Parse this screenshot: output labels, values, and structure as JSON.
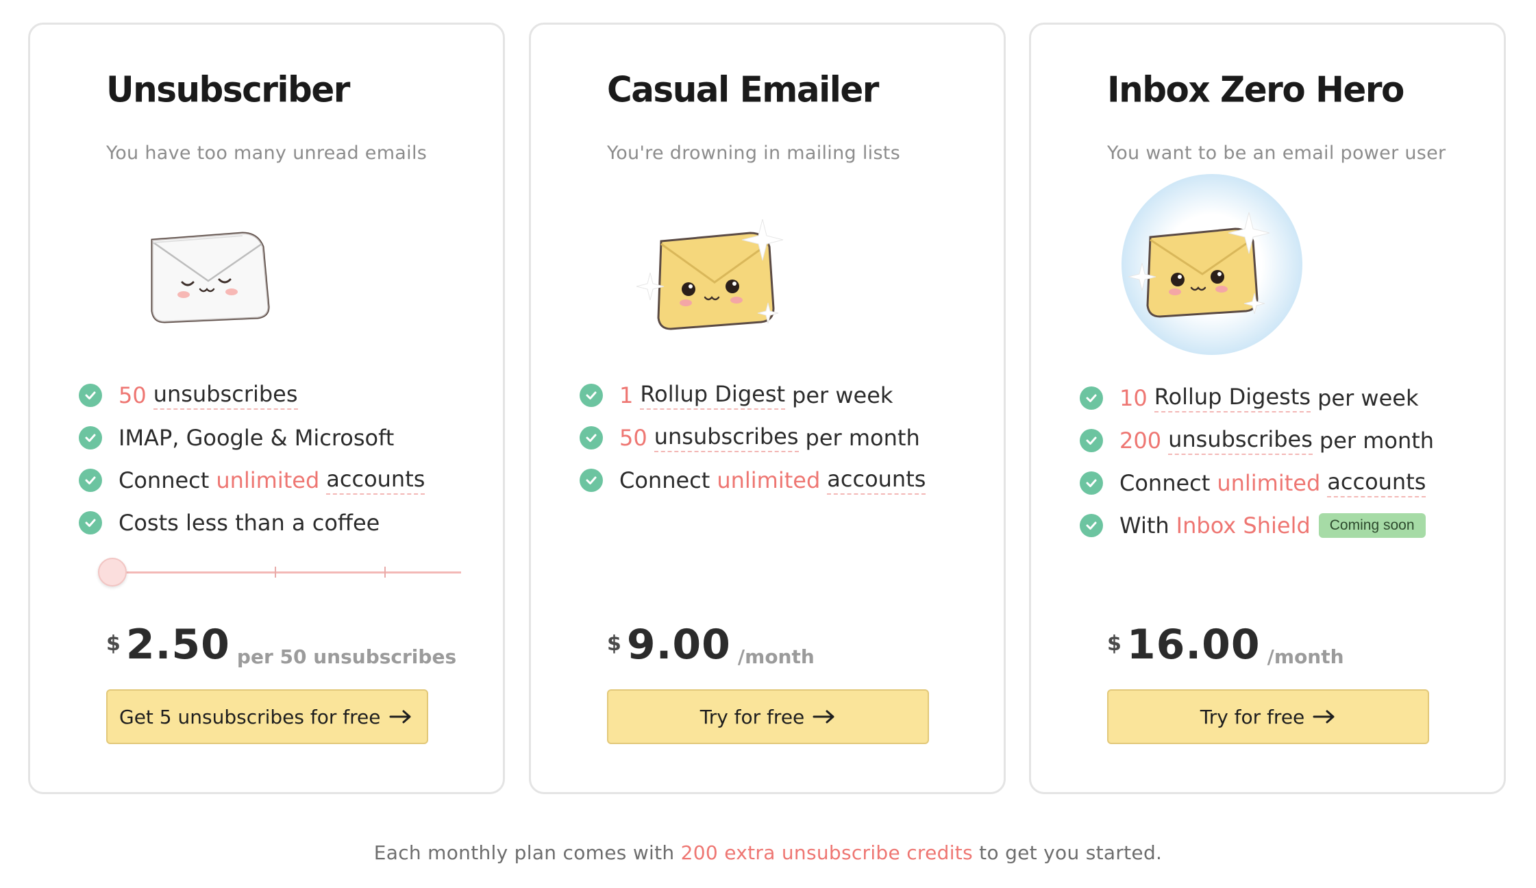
{
  "plans": [
    {
      "title": "Unsubscriber",
      "subtitle": "You have too many unread emails",
      "features": [
        {
          "num": "50",
          "text": "unsubscribes"
        },
        {
          "text": "IMAP, Google & Microsoft"
        },
        {
          "pre": "Connect",
          "hl": "unlimited",
          "post": "accounts"
        },
        {
          "text": "Costs less than a coffee"
        }
      ],
      "slider_position": 0,
      "currency": "$",
      "price": "2.50",
      "period": "per 50 unsubscribes",
      "cta_label": "Get 5 unsubscribes for free"
    },
    {
      "title": "Casual Emailer",
      "subtitle": "You're drowning in mailing lists",
      "features": [
        {
          "num": "1",
          "text": "Rollup Digest",
          "post": "per week"
        },
        {
          "num": "50",
          "text": "unsubscribes",
          "post": "per month"
        },
        {
          "pre": "Connect",
          "hl": "unlimited",
          "post": "accounts"
        }
      ],
      "currency": "$",
      "price": "9.00",
      "period": "/month",
      "cta_label": "Try for free"
    },
    {
      "title": "Inbox Zero Hero",
      "subtitle": "You want to be an email power user",
      "features": [
        {
          "num": "10",
          "text": "Rollup Digests",
          "post": "per week"
        },
        {
          "num": "200",
          "text": "unsubscribes",
          "post": "per month"
        },
        {
          "pre": "Connect",
          "hl": "unlimited",
          "post": "accounts"
        },
        {
          "pre": "With",
          "hl": "Inbox Shield",
          "badge": "Coming soon"
        }
      ],
      "currency": "$",
      "price": "16.00",
      "period": "/month",
      "cta_label": "Try for free"
    }
  ],
  "footer": {
    "pre": "Each monthly plan comes with",
    "highlight": "200 extra unsubscribe credits",
    "post": "to get you started."
  },
  "colors": {
    "accent": "#ee7672",
    "check": "#6cc4a0",
    "cta_bg": "#fae49a",
    "badge_bg": "#a6dba6"
  }
}
